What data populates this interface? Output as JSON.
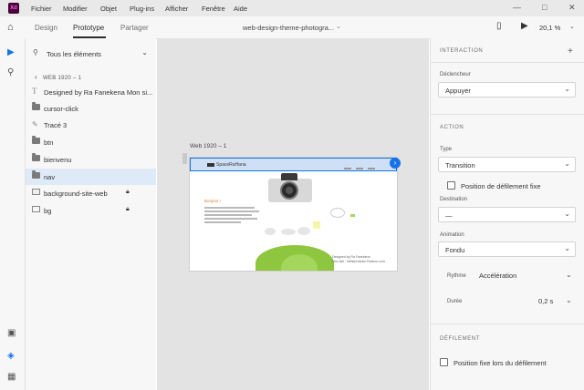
{
  "app": {
    "logo": "Xd"
  },
  "menubar": {
    "items": [
      "Fichier",
      "Modifier",
      "Objet",
      "Plug-ins",
      "Afficher",
      "Fenêtre",
      "Aide"
    ]
  },
  "window_controls": {
    "minimize": "—",
    "maximize": "□",
    "close": "✕"
  },
  "toolbar": {
    "tabs": [
      "Design",
      "Prototype",
      "Partager"
    ],
    "active_tab": "Prototype",
    "document_title": "web-design-theme-photogra...",
    "zoom": "20,1 %"
  },
  "layers": {
    "filter_label": "Tous les éléments",
    "breadcrumb": "WEB 1920 – 1",
    "items": [
      {
        "name": "Designed by Ra Fanekena Mon si...",
        "icon": "text-icon",
        "locked": false,
        "selected": false
      },
      {
        "name": "cursor-click",
        "icon": "folder-icon",
        "locked": false,
        "selected": false
      },
      {
        "name": "Tracé 3",
        "icon": "path-icon",
        "locked": false,
        "selected": false
      },
      {
        "name": "btn",
        "icon": "folder-icon",
        "locked": false,
        "selected": false
      },
      {
        "name": "bienvenu",
        "icon": "folder-icon",
        "locked": false,
        "selected": false
      },
      {
        "name": "nav",
        "icon": "folder-icon",
        "locked": false,
        "selected": true
      },
      {
        "name": "background-site-web",
        "icon": "image-icon",
        "locked": true,
        "selected": false
      },
      {
        "name": "bg",
        "icon": "rectangle-icon",
        "locked": true,
        "selected": false
      }
    ]
  },
  "canvas": {
    "artboard_label": "Web 1920 – 1",
    "nav_logo": "SpaceRaHana",
    "hello_text": "Bonjour !",
    "bottom_text": [
      "Designed by Ra Fanekena",
      "Mon site : WilliamVanier.Flaticon.com"
    ]
  },
  "interaction_panel": {
    "interaction_header": "INTERACTION",
    "trigger_label": "Déclencheur",
    "trigger_value": "Appuyer",
    "action_header": "ACTION",
    "type_label": "Type",
    "type_value": "Transition",
    "preserve_scroll_label": "Position de défilement fixe",
    "destination_label": "Destination",
    "destination_value": "—",
    "animation_label": "Animation",
    "animation_value": "Fondu",
    "easing_label": "Rythme",
    "easing_value": "Accélération",
    "duration_label": "Durée",
    "duration_value": "0,2 s",
    "scroll_header": "DÉFILEMENT",
    "fixed_position_label": "Position fixe lors du défilement"
  },
  "colors": {
    "accent": "#1473e6",
    "selection": "#dfeaf8",
    "hill": "#8ec63f"
  }
}
